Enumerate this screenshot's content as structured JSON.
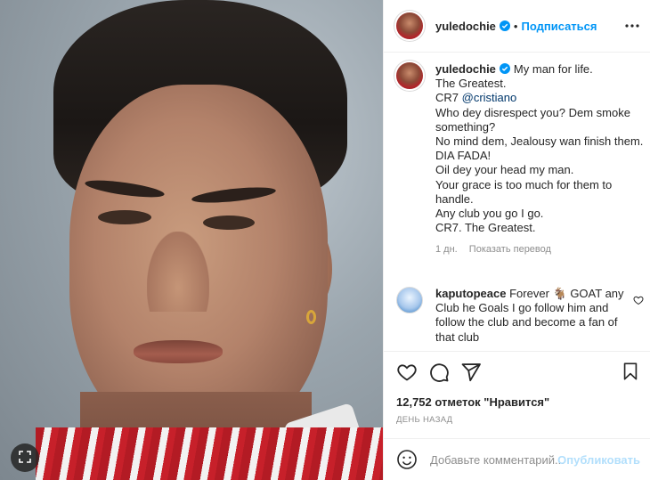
{
  "post": {
    "author": "yuledochie",
    "follow_label": "Подписаться",
    "separator": "•",
    "caption_lines": [
      "My man for life.",
      "The Greatest.",
      "CR7 ",
      "Who dey disrespect you? Dem smoke something?",
      "No mind dem, Jealousy wan finish them.",
      "DIA FADA!",
      "Oil dey your head my man.",
      "Your grace is too much for them to handle.",
      "Any club you go I go.",
      "CR7. The Greatest."
    ],
    "mention": "@cristiano",
    "caption_age": "1 дн.",
    "translate_label": "Показать перевод",
    "comment": {
      "author": "kaputopeace",
      "text_before_emoji": "Forever ",
      "emoji": "🐐",
      "text_after_emoji": " GOAT any Club he Goals I go follow him and follow the club and become a fan of that club"
    },
    "likes_text": "12,752 отметок \"Нравится\"",
    "date_text": "ДЕНЬ НАЗАД",
    "add_comment_placeholder": "Добавьте комментарий...",
    "publish_label": "Опубликовать"
  },
  "icons": {
    "verified": "verified-badge-icon",
    "more": "more-options-icon",
    "like": "heart-icon",
    "comment": "comment-bubble-icon",
    "share": "paper-plane-icon",
    "save": "bookmark-icon",
    "emoji": "smiley-icon",
    "expand": "expand-icon"
  },
  "colors": {
    "accent": "#0095f6",
    "text": "#262626",
    "muted": "#8e8e8e",
    "publish_disabled": "#b2dffc"
  }
}
